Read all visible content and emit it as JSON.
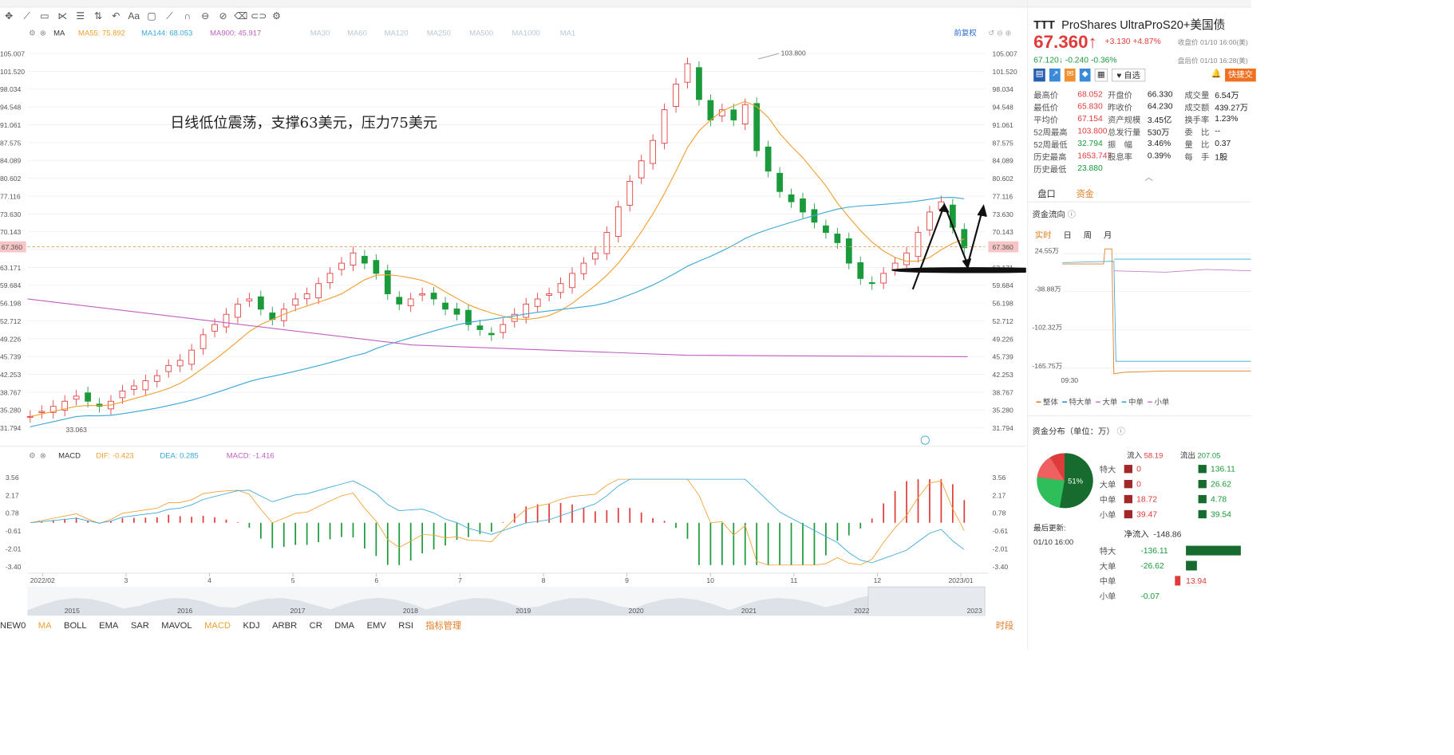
{
  "toolbar": {
    "icons": [
      "crosshair-icon",
      "line-icon",
      "rect-icon",
      "fork-icon",
      "channel-icon",
      "arrows-icon",
      "text-icon",
      "comment-icon",
      "ruler-icon",
      "magnet-icon",
      "lock-icon",
      "eye-icon",
      "trash-icon",
      "link-icon",
      "gear-icon"
    ],
    "text_icon": "Aa"
  },
  "ma_legend": {
    "name": "MA",
    "ma55": "MA55: 75.892",
    "ma144": "MA144: 68.053",
    "ma900": "MA900: 45.917",
    "rest": [
      "MA30",
      "MA60",
      "MA120",
      "MA250",
      "MA500",
      "MA1000",
      "MA1"
    ],
    "adjust": "前复权"
  },
  "annotation": "日线低位震荡，支撑63美元，压力75美元",
  "peak_label": "103.800",
  "low_label": "33.063",
  "price_tag": "67.360",
  "macd_legend": {
    "name": "MACD",
    "dif": "DIF: -0.423",
    "dea": "DEA: 0.285",
    "macd": "MACD: -1.416"
  },
  "colors": {
    "up": "#e03b3b",
    "down": "#1a9a3b",
    "ma55": "#f0a030",
    "ma144": "#3aa8d8",
    "ma900": "#c060c0"
  },
  "chart_data": {
    "type": "candlestick",
    "price_axis": [
      105.007,
      101.52,
      98.034,
      94.548,
      91.061,
      87.575,
      84.089,
      80.602,
      77.116,
      73.63,
      70.143,
      66.657,
      63.171,
      59.684,
      56.198,
      52.712,
      49.226,
      45.739,
      42.253,
      38.767,
      35.28,
      31.794
    ],
    "macd_axis": [
      3.56,
      2.17,
      0.78,
      -0.61,
      -2.01,
      -3.4
    ],
    "months": [
      "2022/02",
      "3",
      "4",
      "5",
      "6",
      "7",
      "8",
      "9",
      "10",
      "11",
      "12",
      "2023/01"
    ],
    "overview_years": [
      "2015",
      "2016",
      "2017",
      "2018",
      "2019",
      "2020",
      "2021",
      "2022",
      "2023"
    ],
    "close_series": [
      34,
      35,
      36,
      37,
      38,
      37,
      36,
      37,
      39,
      40,
      41,
      42,
      44,
      45,
      47,
      50,
      52,
      54,
      56,
      57,
      55,
      53,
      55,
      57,
      58,
      60,
      62,
      64,
      66,
      64,
      62,
      58,
      56,
      57,
      58,
      57,
      55,
      54,
      52,
      51,
      50,
      52,
      54,
      56,
      57,
      58,
      60,
      62,
      64,
      66,
      70,
      75,
      80,
      84,
      88,
      94,
      99,
      103,
      96,
      92,
      94,
      92,
      95,
      86,
      82,
      78,
      76,
      74,
      72,
      70,
      68,
      64,
      61,
      60,
      62,
      64,
      66,
      70,
      74,
      76,
      71,
      67
    ]
  },
  "right": {
    "ticker": "TTT",
    "name": "ProShares UltraProS20+美国债",
    "price": "67.360",
    "arrow": "↑",
    "change": "+3.130",
    "pct": "+4.87%",
    "close_label": "收盘价 01/10 16:00(美)",
    "after_price": "67.120",
    "after_arrow": "↓",
    "after_change": "-0.240",
    "after_pct": "-0.36%",
    "after_label": "盘后价 01/10 16:28(美)",
    "watch": "自选",
    "quick": "快捷交",
    "stats": [
      [
        "最高价",
        "68.052",
        "开盘价",
        "66.330",
        "成交量",
        "6.54万"
      ],
      [
        "最低价",
        "65.830",
        "昨收价",
        "64.230",
        "成交额",
        "439.27万"
      ],
      [
        "平均价",
        "67.154",
        "资产规模",
        "3.45亿",
        "换手率",
        "1.23%"
      ],
      [
        "52周最高",
        "103.800",
        "总发行量",
        "530万",
        "委　比",
        "--"
      ],
      [
        "52周最低",
        "32.794",
        "振　幅",
        "3.46%",
        "量　比",
        "0.37"
      ],
      [
        "历史最高",
        "1653.747",
        "股息率",
        "0.39%",
        "每　手",
        "1股"
      ],
      [
        "历史最低",
        "23.880",
        "",
        "",
        "",
        ""
      ]
    ],
    "tabs": [
      "盘口",
      "资金"
    ],
    "flow_title": "资金流向",
    "flow_tabs": [
      "实时",
      "日",
      "周",
      "月"
    ],
    "flow_axis": [
      "24.55万",
      "-38.88万",
      "-102.32万",
      "-165.75万"
    ],
    "flow_time": "09:30",
    "flow_legend": [
      "整体",
      "特大单",
      "大单",
      "中单",
      "小单"
    ],
    "dist_title": "资金分布（单位：万）",
    "in_label": "流入",
    "in_val": "58.19",
    "out_label": "流出",
    "out_val": "207.05",
    "pie_pct": "51%",
    "dist_rows": [
      [
        "特大",
        "0",
        "136.11"
      ],
      [
        "大单",
        "0",
        "26.62"
      ],
      [
        "中单",
        "18.72",
        "4.78"
      ],
      [
        "小单",
        "39.47",
        "39.54"
      ]
    ],
    "last_update": "最后更新:",
    "last_time": "01/10 16:00",
    "net_title": "净流入",
    "net_val": "-148.86",
    "net_rows": [
      [
        "特大",
        "-136.11"
      ],
      [
        "大单",
        "-26.62"
      ],
      [
        "中单",
        "13.94"
      ],
      [
        "小单",
        "-0.07"
      ]
    ]
  },
  "bottom": {
    "indicators": [
      "NEW0",
      "MA",
      "BOLL",
      "EMA",
      "SAR",
      "MAVOL",
      "MACD",
      "KDJ",
      "ARBR",
      "CR",
      "DMA",
      "EMV",
      "RSI",
      "指标管理"
    ],
    "period": "时段"
  }
}
